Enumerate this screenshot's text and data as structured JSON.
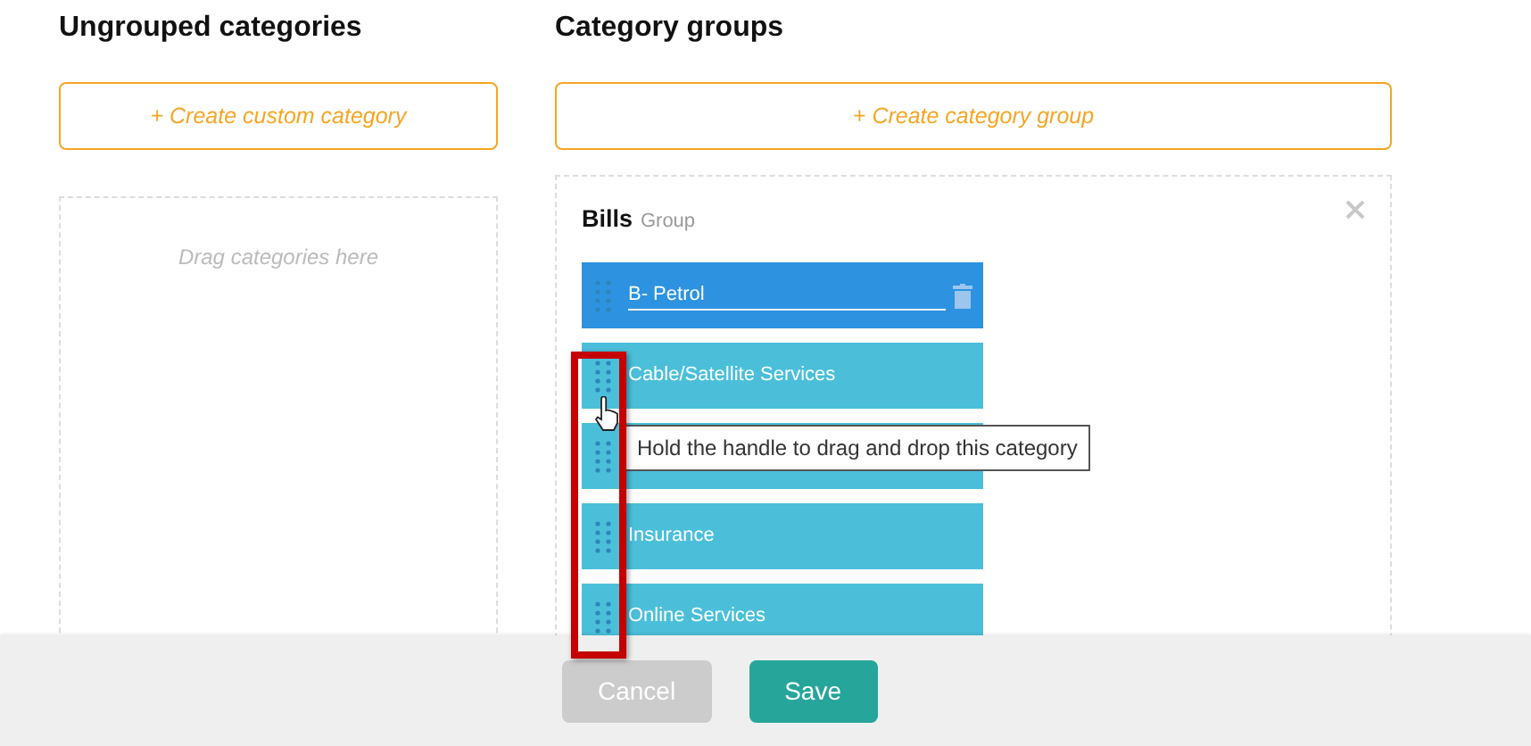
{
  "ungrouped": {
    "title": "Ungrouped categories",
    "create_button": "+ Create custom category",
    "dropzone_hint": "Drag categories here"
  },
  "groups_panel": {
    "title": "Category groups",
    "create_button": "+ Create category group",
    "groups": [
      {
        "name": "Bills",
        "suffix": "Group",
        "categories": [
          {
            "label": "B- Petrol",
            "editing": true
          },
          {
            "label": "Cable/Satellite Services",
            "editing": false
          },
          {
            "editing": false
          },
          {
            "label": "Insurance",
            "editing": false
          },
          {
            "label": "Online Services",
            "editing": false
          }
        ]
      }
    ]
  },
  "tooltip": "Hold the handle to drag and drop this category",
  "footer": {
    "buttons": [
      {
        "label": "Cancel",
        "disabled": true
      },
      {
        "label": "Save",
        "disabled": false
      }
    ]
  }
}
